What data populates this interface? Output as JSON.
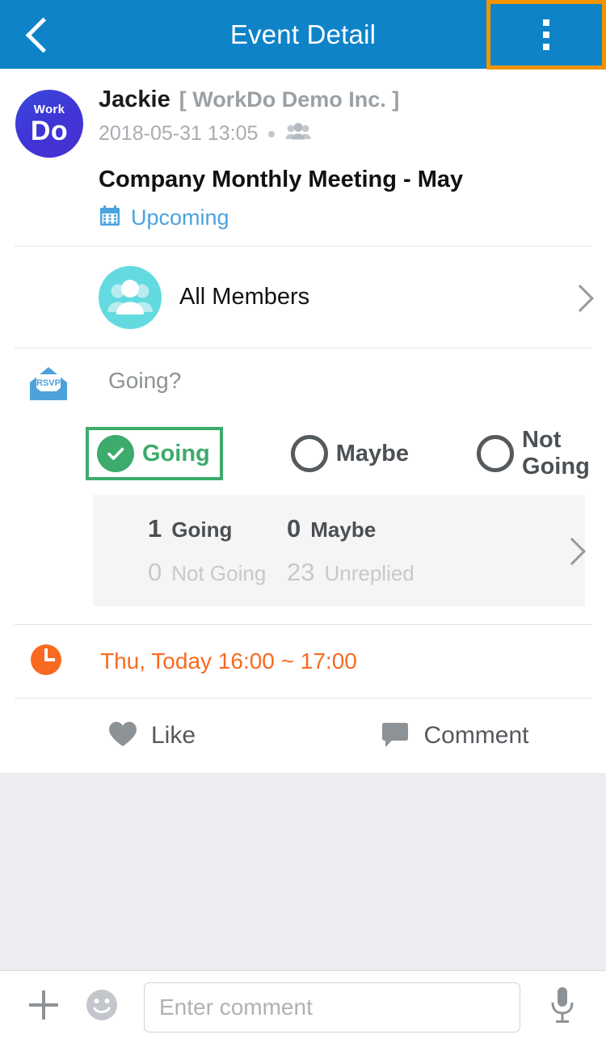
{
  "header": {
    "title": "Event Detail",
    "back_icon": "back-chevron-icon",
    "overflow_icon": "overflow-menu-icon",
    "background_color": "#0e83c8",
    "highlight_color": "#f29400"
  },
  "post": {
    "avatar": {
      "top_text": "Work",
      "main_text": "Do",
      "name": "workdo-logo-avatar"
    },
    "poster_name": "Jackie",
    "poster_org": "[ WorkDo Demo Inc. ]",
    "timestamp": "2018-05-31 13:05",
    "audience_icon": "group-members-icon",
    "event_title": "Company Monthly Meeting - May",
    "status_icon": "calendar-icon",
    "status_text": "Upcoming",
    "status_color": "#4ba3de"
  },
  "members": {
    "icon": "all-members-avatar-icon",
    "label": "All Members",
    "chevron_icon": "chevron-right-icon"
  },
  "rsvp": {
    "icon": "rsvp-envelope-icon",
    "icon_text": "RSVP",
    "question": "Going?",
    "options": [
      {
        "label": "Going",
        "selected": true,
        "color": "#3cab6b"
      },
      {
        "label": "Maybe",
        "selected": false,
        "color": "#4c5155"
      },
      {
        "label": "Not Going",
        "selected": false,
        "color": "#4c5155"
      }
    ],
    "stats": {
      "going_count": "1",
      "going_label": "Going",
      "maybe_count": "0",
      "maybe_label": "Maybe",
      "not_going_count": "0",
      "not_going_label": "Not Going",
      "unreplied_count": "23",
      "unreplied_label": "Unreplied",
      "chevron_icon": "chevron-right-icon"
    }
  },
  "time": {
    "icon": "clock-icon",
    "text": "Thu, Today 16:00 ~ 17:00",
    "color": "#f86a21"
  },
  "actions": {
    "like": {
      "icon": "heart-icon",
      "label": "Like"
    },
    "comment": {
      "icon": "comment-bubble-icon",
      "label": "Comment"
    }
  },
  "bottom_bar": {
    "add_icon": "plus-icon",
    "emoji_icon": "smiley-icon",
    "input_value": "",
    "input_placeholder": "Enter comment",
    "mic_icon": "microphone-icon"
  }
}
